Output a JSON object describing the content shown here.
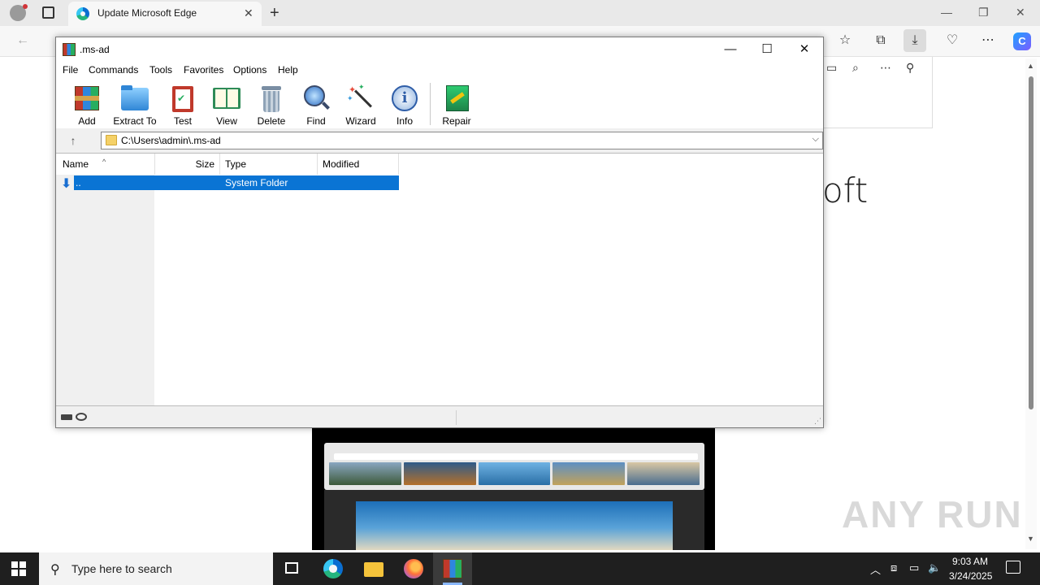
{
  "browser": {
    "tab_title": "Update Microsoft Edge",
    "page_heading_fragment": "oft",
    "watermark": "ANY RUN"
  },
  "winrar": {
    "title": ".ms-ad",
    "menu": [
      "File",
      "Commands",
      "Tools",
      "Favorites",
      "Options",
      "Help"
    ],
    "toolbar": [
      {
        "label": "Add",
        "icon": "add-archive-icon"
      },
      {
        "label": "Extract To",
        "icon": "extract-folder-icon"
      },
      {
        "label": "Test",
        "icon": "test-clipboard-icon"
      },
      {
        "label": "View",
        "icon": "view-book-icon"
      },
      {
        "label": "Delete",
        "icon": "delete-trash-icon"
      },
      {
        "label": "Find",
        "icon": "find-magnifier-icon"
      },
      {
        "label": "Wizard",
        "icon": "wizard-wand-icon"
      },
      {
        "label": "Info",
        "icon": "info-icon"
      },
      {
        "label": "Repair",
        "icon": "repair-kit-icon"
      }
    ],
    "path": "C:\\Users\\admin\\.ms-ad",
    "columns": {
      "name": "Name",
      "size": "Size",
      "type": "Type",
      "modified": "Modified"
    },
    "rows": [
      {
        "name": "..",
        "size": "",
        "type": "System Folder",
        "modified": ""
      }
    ]
  },
  "taskbar": {
    "search_placeholder": "Type here to search",
    "time": "9:03 AM",
    "date": "3/24/2025"
  },
  "colors": {
    "selection": "#0a74d4",
    "taskbar": "#1f1f1f"
  }
}
